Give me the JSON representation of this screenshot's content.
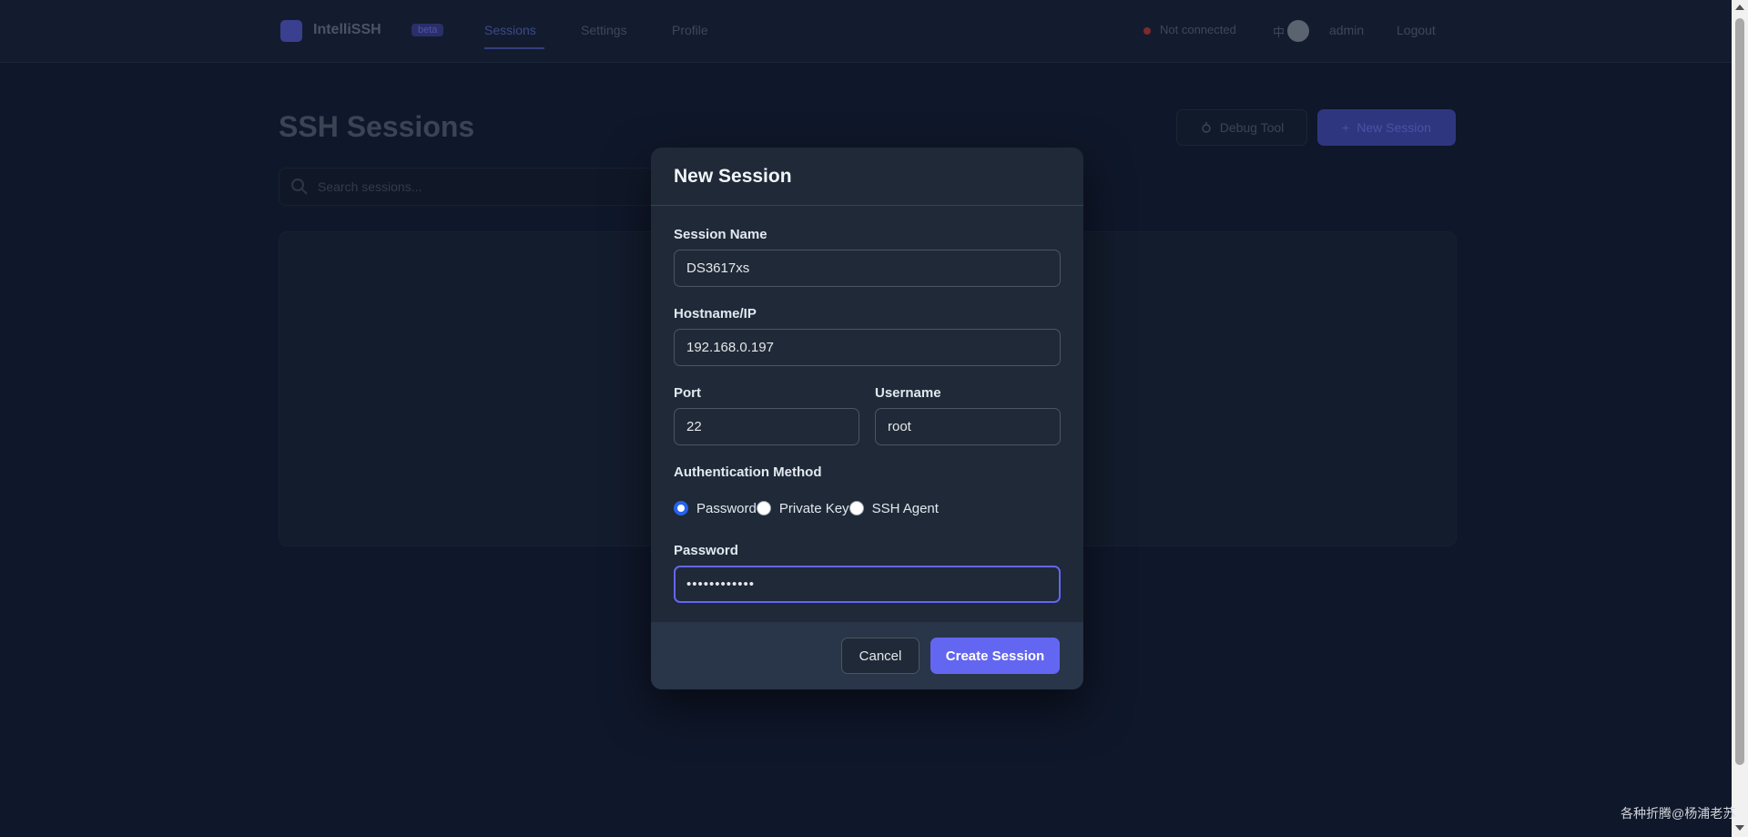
{
  "app": {
    "brand": "IntelliSSH",
    "badge": "beta",
    "nav": [
      "Sessions",
      "Settings",
      "Profile"
    ],
    "connection_status": "Not connected",
    "language": "中",
    "user": "admin",
    "logout": "Logout"
  },
  "page": {
    "title": "SSH Sessions",
    "debug_button": "Debug Tool",
    "new_session_button": "New Session",
    "search_placeholder": "Search sessions..."
  },
  "modal": {
    "title": "New Session",
    "session_name_label": "Session Name",
    "session_name_value": "DS3617xs",
    "hostname_label": "Hostname/IP",
    "hostname_value": "192.168.0.197",
    "port_label": "Port",
    "port_value": "22",
    "username_label": "Username",
    "username_value": "root",
    "auth_label": "Authentication Method",
    "auth_options": [
      "Password",
      "Private Key",
      "SSH Agent"
    ],
    "auth_selected": "Password",
    "password_label": "Password",
    "password_value": "••••••••••••",
    "cancel_button": "Cancel",
    "create_button": "Create Session"
  },
  "watermark": "各种折腾@杨浦老苏",
  "colors": {
    "accent": "#6366f1",
    "modal_bg": "#1f2937",
    "page_bg": "#0f172a",
    "radio_checked": "#2563eb"
  }
}
